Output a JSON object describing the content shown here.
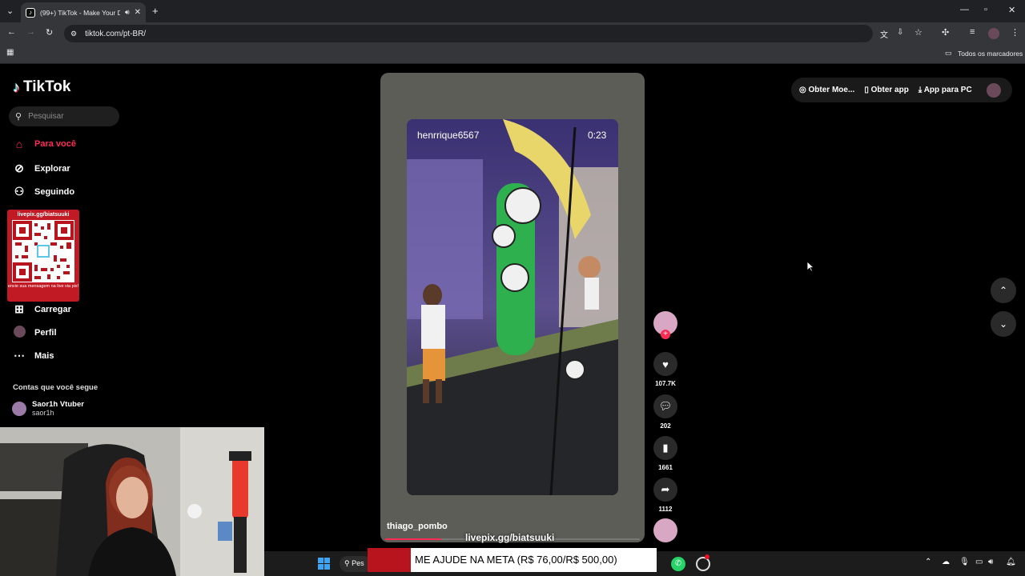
{
  "browser": {
    "tab_title": "(99+) TikTok - Make Your Da",
    "url": "tiktok.com/pt-BR/",
    "bookmarks_label": "Todos os marcadores"
  },
  "sidebar": {
    "logo": "TikTok",
    "search_placeholder": "Pesquisar",
    "items": [
      {
        "label": "Para você",
        "icon": "home-icon",
        "active": true
      },
      {
        "label": "Explorar",
        "icon": "compass-icon"
      },
      {
        "label": "Seguindo",
        "icon": "following-icon"
      },
      {
        "label": "Carregar",
        "icon": "upload-icon"
      },
      {
        "label": "Perfil",
        "icon": "profile-icon"
      },
      {
        "label": "Mais",
        "icon": "more-icon"
      }
    ],
    "following_heading": "Contas que você segue",
    "following": [
      {
        "name": "Saor1h Vtuber",
        "handle": "saor1h"
      }
    ]
  },
  "qr_overlay": {
    "title": "livepix.gg/biatsuuki",
    "subtitle": "envie sua mensagem na live via pix!"
  },
  "header": {
    "coins": "Obter Moe...",
    "get_app": "Obter app",
    "pc_app": "App para PC"
  },
  "video": {
    "inner_username": "henrrique6567",
    "inner_time": "0:23",
    "author": "thiago_pombo"
  },
  "actions": {
    "likes": "107.7K",
    "comments": "202",
    "saves": "1661",
    "shares": "1112"
  },
  "overlay": {
    "livepix": "livepix.gg/biatsuuki",
    "meta": "ME AJUDE NA META (R$ 76,00/R$ 500,00)"
  },
  "taskbar": {
    "search_text": "Pes"
  },
  "colors": {
    "accent": "#fe2c55",
    "video_bg": "#5c5d56"
  }
}
